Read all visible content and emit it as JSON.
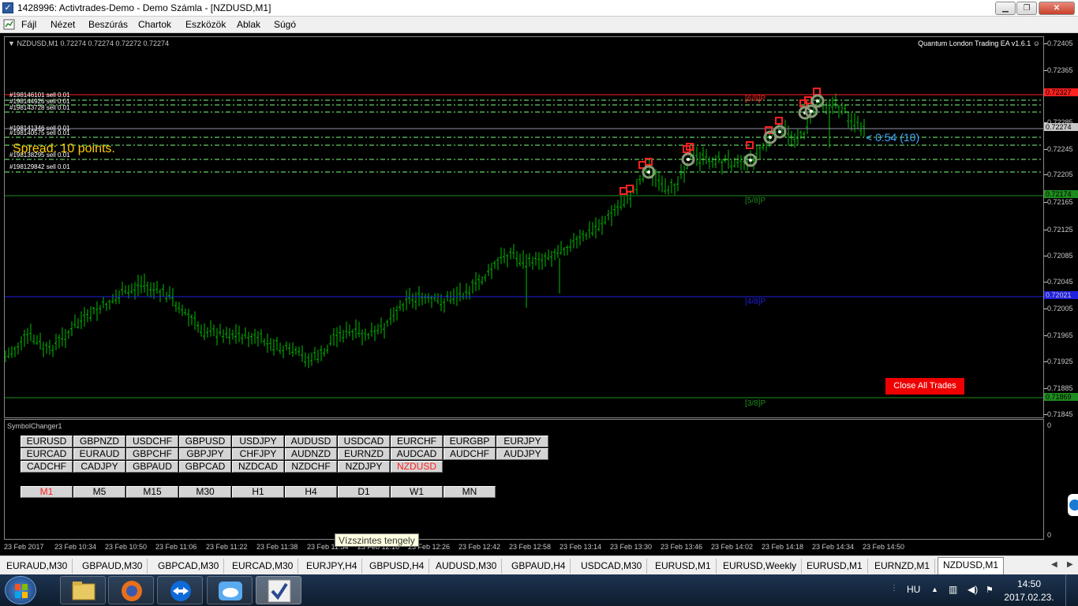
{
  "window": {
    "title": "1428996: Activtrades-Demo - Demo Számla - [NZDUSD,M1]"
  },
  "menu": [
    "Fájl",
    "Nézet",
    "Beszúrás",
    "Chartok",
    "Eszközök",
    "Ablak",
    "Súgó"
  ],
  "chart": {
    "header": "NZDUSD,M1  0.72274 0.72274 0.72272 0.72274",
    "ea_label": "Quantum London Trading EA  v1.6.1",
    "spread_label": "Spread: 10 points.",
    "countdown": "< 0:54 (10)",
    "close_button": "Close All Trades",
    "tooltip": "Vízszintes tengely",
    "orders": [
      "#198146101 sell 0.01",
      "#198144926 sell 0.01",
      "#198143728 sell 0.01",
      "#198141346 sell 0.01",
      "#198140575 sell 0.01",
      "#198138295 sell 0.01",
      "#198129842 sell 0.01"
    ],
    "levels": {
      "l68": "[6/8]P",
      "l58": "[5/8]P",
      "l48": "[4/8]P",
      "l38": "[3/8]P"
    },
    "colors": {
      "candle": "#00c000",
      "resistance": "#ff2020",
      "support_green": "#1e8c1e",
      "mid_blue": "#2020e0",
      "order_line": "#7cff7c"
    }
  },
  "price_scale": {
    "labels": [
      "0.72405",
      "0.72365",
      "0.72285",
      "0.72245",
      "0.72205",
      "0.72165",
      "0.72125",
      "0.72085",
      "0.72045",
      "0.72005",
      "0.71965",
      "0.71925",
      "0.71885",
      "0.71845"
    ],
    "resistance_box": "0.72327",
    "current_box": "0.72274",
    "support_box": "0.72174",
    "mid_box": "0.72021",
    "low_box": "0.71869"
  },
  "subwindow": {
    "title": "SymbolChanger1",
    "scale_top": "0",
    "scale_bottom": "0",
    "symbols": [
      [
        "EURUSD",
        "GBPNZD",
        "USDCHF",
        "GBPUSD",
        "USDJPY",
        "AUDUSD",
        "USDCAD",
        "EURCHF",
        "EURGBP",
        "EURJPY"
      ],
      [
        "EURCAD",
        "EURAUD",
        "GBPCHF",
        "GBPJPY",
        "CHFJPY",
        "AUDNZD",
        "EURNZD",
        "AUDCAD",
        "AUDCHF",
        "AUDJPY"
      ],
      [
        "CADCHF",
        "CADJPY",
        "GBPAUD",
        "GBPCAD",
        "NZDCAD",
        "NZDCHF",
        "NZDJPY",
        "NZDUSD"
      ]
    ],
    "selected_symbol": "NZDUSD",
    "timeframes": [
      "M1",
      "M5",
      "M15",
      "M30",
      "H1",
      "H4",
      "D1",
      "W1",
      "MN"
    ],
    "selected_timeframe": "M1"
  },
  "time_axis": [
    "23 Feb 2017",
    "23 Feb 10:34",
    "23 Feb 10:50",
    "23 Feb 11:06",
    "23 Feb 11:22",
    "23 Feb 11:38",
    "23 Feb 11:54",
    "23 Feb 12:10",
    "23 Feb 12:26",
    "23 Feb 12:42",
    "23 Feb 12:58",
    "23 Feb 13:14",
    "23 Feb 13:30",
    "23 Feb 13:46",
    "23 Feb 14:02",
    "23 Feb 14:18",
    "23 Feb 14:34",
    "23 Feb 14:50"
  ],
  "tabs": [
    "EURAUD,M30",
    "GBPAUD,M30",
    "GBPCAD,M30",
    "EURCAD,M30",
    "EURJPY,H4",
    "GBPUSD,H4",
    "AUDUSD,M30",
    "GBPAUD,H4",
    "USDCAD,M30",
    "EURUSD,M1",
    "EURUSD,Weekly",
    "EURUSD,M1",
    "EURNZD,M1",
    "NZDUSD,M1"
  ],
  "active_tab": "NZDUSD,M1",
  "taskbar": {
    "lang": "HU",
    "time": "14:50",
    "date": "2017.02.23."
  }
}
